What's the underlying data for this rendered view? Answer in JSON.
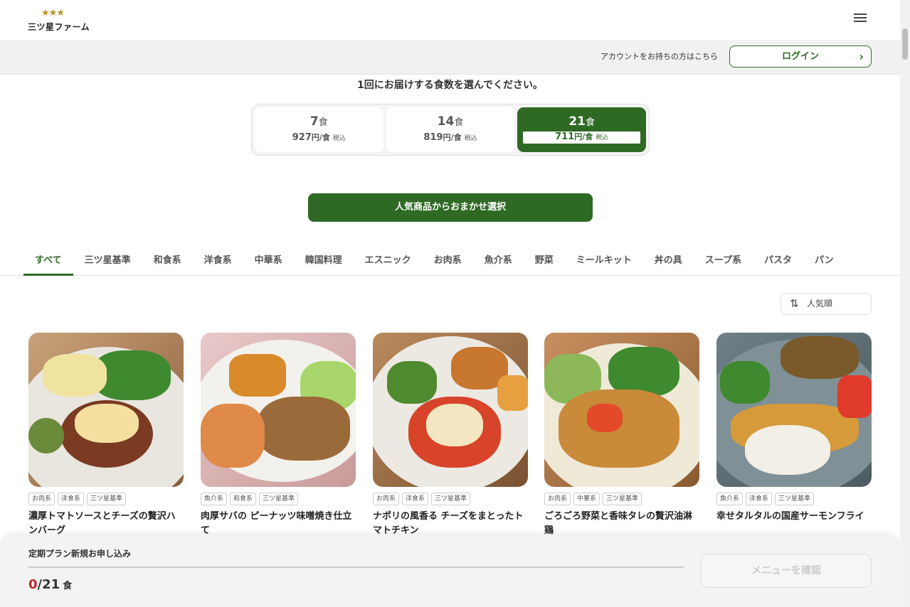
{
  "brand": {
    "stars": "★★★",
    "name": "三ツ星ファーム"
  },
  "account": {
    "prompt": "アカウントをお持ちの方はこちら",
    "login_label": "ログイン"
  },
  "selection": {
    "title": "1回にお届けする食数を選んでください。",
    "plans": [
      {
        "count": "7",
        "unit": "食",
        "price": "927",
        "price_unit": "円/食",
        "tax": "税込"
      },
      {
        "count": "14",
        "unit": "食",
        "price": "819",
        "price_unit": "円/食",
        "tax": "税込"
      },
      {
        "count": "21",
        "unit": "食",
        "price": "711",
        "price_unit": "円/食",
        "tax": "税込"
      }
    ],
    "selected_index": 2
  },
  "omakase_label": "人気商品からおまかせ選択",
  "tabs": [
    "すべて",
    "三ツ星基準",
    "和食系",
    "洋食系",
    "中華系",
    "韓国料理",
    "エスニック",
    "お肉系",
    "魚介系",
    "野菜",
    "ミールキット",
    "丼の具",
    "スープ系",
    "パスタ",
    "パン"
  ],
  "sort": {
    "label": "人気順"
  },
  "products": [
    {
      "tags": [
        "お肉系",
        "洋食系",
        "三ツ星基準"
      ],
      "title": "濃厚トマトソースとチーズの贅沢ハンバーグ"
    },
    {
      "tags": [
        "魚介系",
        "和食系",
        "三ツ星基準"
      ],
      "title": "肉厚サバの ピーナッツ味噌焼き仕立て"
    },
    {
      "tags": [
        "お肉系",
        "洋食系",
        "三ツ星基準"
      ],
      "title": "ナポリの風香る チーズをまとったトマトチキン"
    },
    {
      "tags": [
        "お肉系",
        "中華系",
        "三ツ星基準"
      ],
      "title": "ごろごろ野菜と香味タレの贅沢油淋鶏"
    },
    {
      "tags": [
        "魚介系",
        "洋食系",
        "三ツ星基準"
      ],
      "title": "幸せタルタルの国産サーモンフライ"
    }
  ],
  "bottom": {
    "title": "定期プラン新規お申し込み",
    "current": "0",
    "total": "/21",
    "unit": "食",
    "confirm_label": "メニューを確認"
  },
  "colors": {
    "brand_green": "#2f6a25",
    "count_red": "#c0272d"
  }
}
